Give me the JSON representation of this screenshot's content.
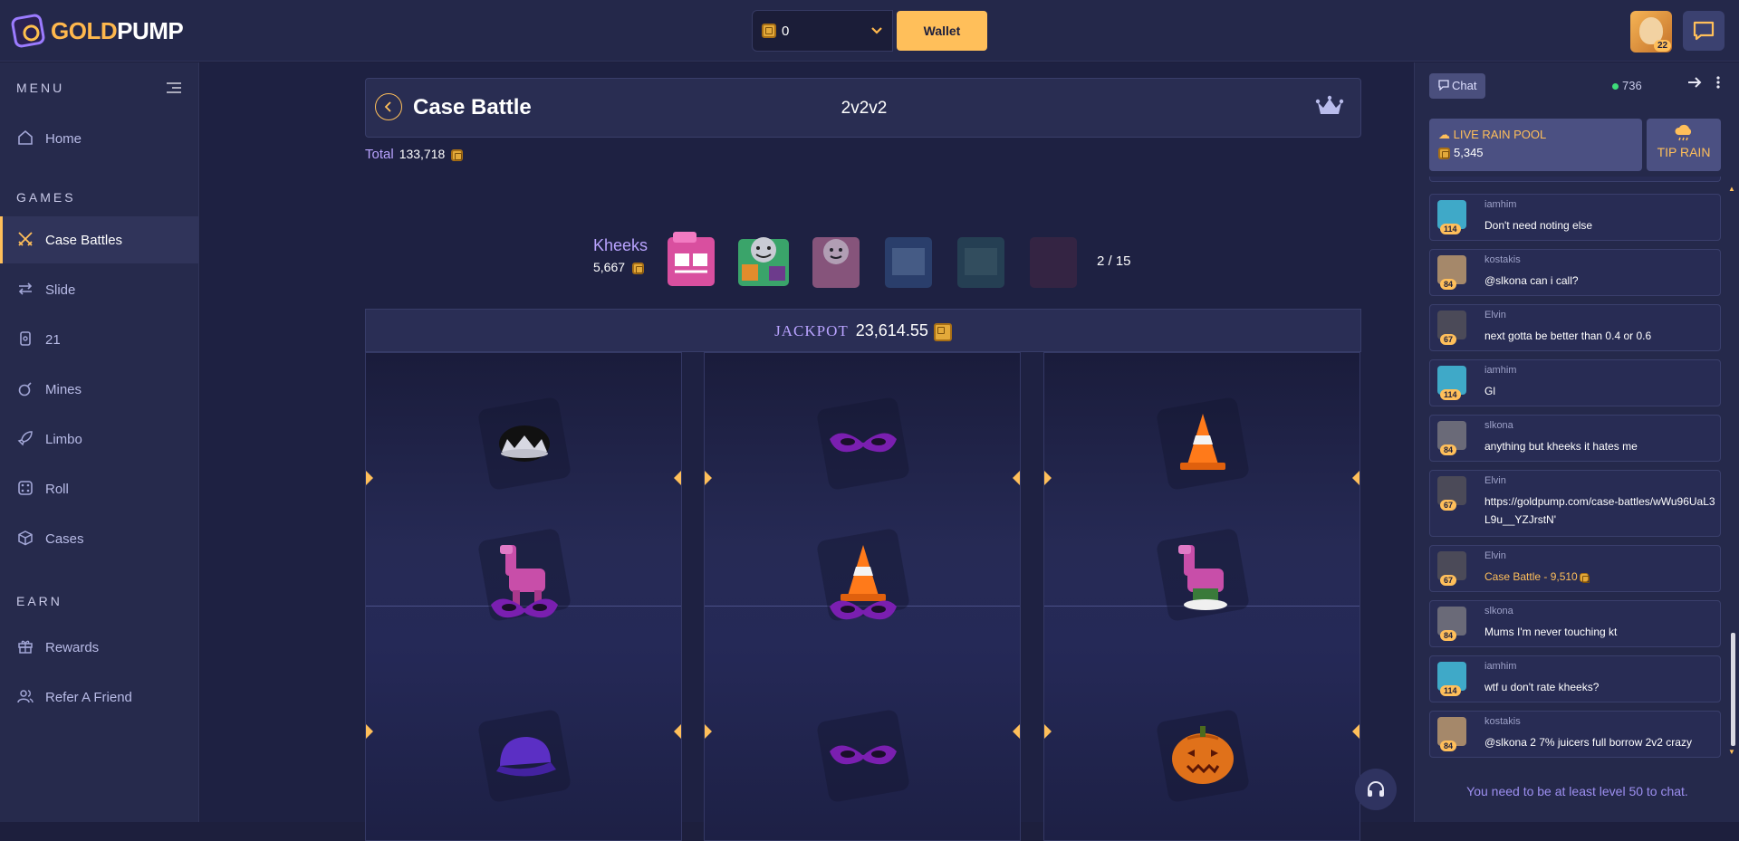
{
  "brand": {
    "part1": "GOLD",
    "part2": "PUMP"
  },
  "header": {
    "balance": "0",
    "wallet_label": "Wallet",
    "user_level": "22"
  },
  "sidebar": {
    "menu_title": "MENU",
    "games_title": "GAMES",
    "earn_title": "EARN",
    "home": "Home",
    "games": [
      {
        "label": "Case Battles",
        "icon": "swords-icon"
      },
      {
        "label": "Slide",
        "icon": "arrows-icon"
      },
      {
        "label": "21",
        "icon": "cards-icon"
      },
      {
        "label": "Mines",
        "icon": "bomb-icon"
      },
      {
        "label": "Limbo",
        "icon": "rocket-icon"
      },
      {
        "label": "Roll",
        "icon": "dice-icon"
      },
      {
        "label": "Cases",
        "icon": "box-icon"
      }
    ],
    "earn": [
      {
        "label": "Rewards",
        "icon": "gift-icon"
      },
      {
        "label": "Refer A Friend",
        "icon": "users-icon"
      }
    ]
  },
  "battle": {
    "title": "Case Battle",
    "mode": "2v2v2",
    "total_label": "Total",
    "total_value": "133,718",
    "case_name": "Kheeks",
    "case_value": "5,667",
    "case_progress": "2 / 15",
    "jackpot_label": "JACKPOT",
    "jackpot_value": "23,614.55"
  },
  "slots": [
    {
      "items": [
        "crown-hat",
        "pink-llama",
        "purple-mask",
        "purple-cap"
      ]
    },
    {
      "items": [
        "purple-mask",
        "traffic-cone",
        "purple-mask",
        "purple-mask"
      ]
    },
    {
      "items": [
        "traffic-cone",
        "pink-llama",
        "pumpkin"
      ]
    }
  ],
  "chat": {
    "tab_label": "Chat",
    "online_count": "736",
    "rain_title": "LIVE RAIN POOL",
    "rain_value": "5,345",
    "tip_label": "TIP RAIN",
    "messages": [
      {
        "user": "iamhim",
        "level": "114",
        "text": "Don't need noting else"
      },
      {
        "user": "kostakis",
        "level": "84",
        "text": "@slkona can i call?"
      },
      {
        "user": "Elvin",
        "level": "67",
        "text": "next gotta be better than 0.4 or 0.6"
      },
      {
        "user": "iamhim",
        "level": "114",
        "text": "Gl"
      },
      {
        "user": "slkona",
        "level": "84",
        "text": "anything but kheeks it hates me"
      },
      {
        "user": "Elvin",
        "level": "67",
        "text": "https://goldpump.com/case-battles/wWu96UaL3L9u__YZJrstN'"
      },
      {
        "user": "Elvin",
        "level": "67",
        "text": "Case Battle - 9,510"
      },
      {
        "user": "slkona",
        "level": "84",
        "text": "Mums I'm never touching kt"
      },
      {
        "user": "iamhim",
        "level": "114",
        "text": "wtf u don't rate kheeks?"
      },
      {
        "user": "kostakis",
        "level": "84",
        "text": "@slkona 2 7% juicers full borrow 2v2 crazy"
      }
    ],
    "level_note": "You need to be at least level 50 to chat."
  },
  "colors": {
    "accent": "#ffbf5a",
    "purple": "#b9a3ff",
    "bg": "#1d1f3d"
  }
}
